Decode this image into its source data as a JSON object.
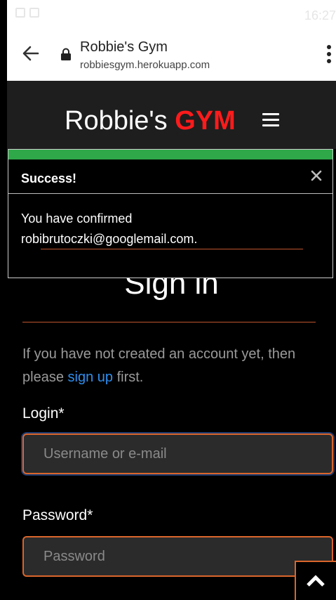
{
  "status_bar": {
    "time": "16:27"
  },
  "browser": {
    "site_title": "Robbie's Gym",
    "url": "robbiesgym.herokuapp.com"
  },
  "site_header": {
    "brand_name": "Robbie's",
    "brand_accent": "GYM",
    "accent_color": "#ff1b1b"
  },
  "alert": {
    "title": "Success!",
    "message_line1": "You have confirmed",
    "message_line2": "robibrutoczki@googlemail.com.",
    "bar_color": "#2fa84a"
  },
  "signin": {
    "title": "Sign in",
    "intro_before": "If you have not created an account yet, then please",
    "signup_link": "sign up",
    "intro_after": "first.",
    "login_label": "Login*",
    "login_placeholder": "Username or e-mail",
    "password_label": "Password*",
    "password_placeholder": "Password",
    "accent_color": "#d9652c",
    "link_color": "#2f8ff0"
  },
  "icons": {
    "back": "arrow-left-icon",
    "lock": "lock-icon",
    "menu": "kebab-menu-icon",
    "hamburger": "hamburger-icon",
    "close": "close-icon",
    "scroll_top": "chevron-up-icon"
  }
}
